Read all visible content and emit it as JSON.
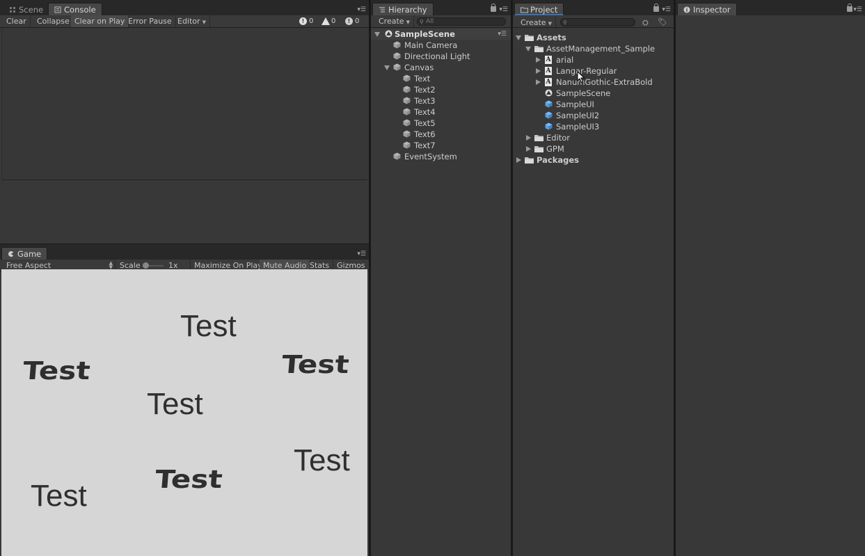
{
  "console": {
    "tabs": [
      {
        "label": "Scene"
      },
      {
        "label": "Console"
      }
    ],
    "toolbar": {
      "clear": "Clear",
      "collapse": "Collapse",
      "clear_on_play": "Clear on Play",
      "error_pause": "Error Pause",
      "editor": "Editor"
    },
    "counts": {
      "info": "0",
      "warning": "0",
      "error": "0"
    }
  },
  "game": {
    "tab": "Game",
    "aspect": "Free Aspect",
    "scale_label": "Scale",
    "scale_value": "1x",
    "maximize_on_play": "Maximize On Play",
    "mute_audio": "Mute Audio",
    "stats": "Stats",
    "gizmos": "Gizmos",
    "texts": [
      "Test",
      "Test",
      "Test",
      "Test",
      "Test",
      "Test",
      "Test"
    ]
  },
  "hierarchy": {
    "tab": "Hierarchy",
    "create": "Create",
    "search_placeholder": "All",
    "scene": "SampleScene",
    "items": [
      "Main Camera",
      "Directional Light",
      "Canvas",
      "Text",
      "Text2",
      "Text3",
      "Text4",
      "Text5",
      "Text6",
      "Text7",
      "EventSystem"
    ]
  },
  "project": {
    "tab": "Project",
    "create": "Create",
    "items": [
      "Assets",
      "AssetManagement_Sample",
      "arial",
      "Langar-Regular",
      "NanumGothic-ExtraBold",
      "SampleScene",
      "SampleUI",
      "SampleUI2",
      "SampleUI3",
      "Editor",
      "GPM",
      "Packages"
    ]
  },
  "inspector": {
    "tab": "Inspector"
  },
  "colors": {
    "panel_bg": "#383838",
    "game_bg": "#d6d6d6",
    "text": "#cdcdcd",
    "active_tab_underline": "#3a72b0"
  }
}
